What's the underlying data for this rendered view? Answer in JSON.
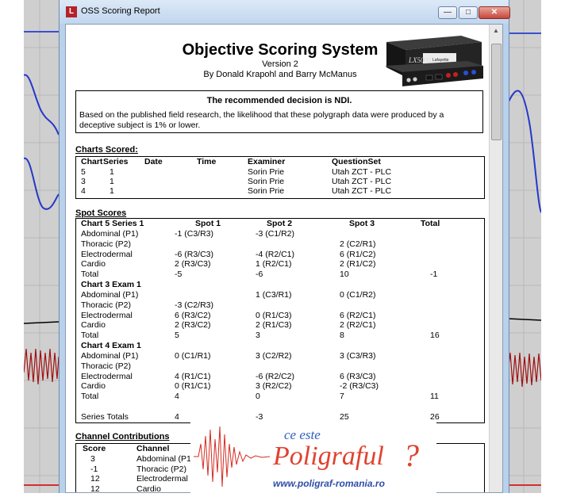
{
  "window": {
    "title": "OSS Scoring Report",
    "minimize_glyph": "—",
    "maximize_glyph": "□",
    "close_glyph": "✕",
    "app_icon_glyph": "L"
  },
  "report": {
    "title": "Objective Scoring System",
    "version": "Version 2",
    "authors": "By Donald Krapohl and Barry McManus",
    "device_label": "LX5000",
    "device_brand": "Lafayette"
  },
  "decision": {
    "title": "The recommended decision is NDI.",
    "text": "Based on the published field research, the likelihood that these polygraph data were produced by a deceptive subject is 1% or lower."
  },
  "charts_scored": {
    "label": "Charts Scored:",
    "headers": [
      "Chart",
      "Series",
      "Date",
      "Time",
      "Examiner",
      "QuestionSet"
    ],
    "rows": [
      [
        "5",
        "1",
        "",
        "",
        "Sorin Prie",
        "Utah ZCT - PLC"
      ],
      [
        "3",
        "1",
        "",
        "",
        "Sorin Prie",
        "Utah ZCT - PLC"
      ],
      [
        "4",
        "1",
        "",
        "",
        "Sorin Prie",
        "Utah ZCT - PLC"
      ]
    ]
  },
  "spot_scores": {
    "label": "Spot Scores",
    "headers": [
      "Spot 1",
      "Spot 2",
      "Spot 3",
      "Total"
    ],
    "groups": [
      {
        "title": "Chart 5 Series 1",
        "rows": [
          {
            "channel": "Abdominal (P1)",
            "s1": "-1 (C3/R3)",
            "s2": "-3 (C1/R2)",
            "s3": "",
            "total": ""
          },
          {
            "channel": "Thoracic (P2)",
            "s1": "",
            "s2": "",
            "s3": "2 (C2/R1)",
            "total": ""
          },
          {
            "channel": "Electrodermal",
            "s1": "-6 (R3/C3)",
            "s2": "-4 (R2/C1)",
            "s3": "6 (R1/C2)",
            "total": ""
          },
          {
            "channel": "Cardio",
            "s1": "2 (R3/C3)",
            "s2": "1 (R2/C1)",
            "s3": "2 (R1/C2)",
            "total": ""
          },
          {
            "channel": "Total",
            "s1": "-5",
            "s2": "-6",
            "s3": "10",
            "total": "-1"
          }
        ]
      },
      {
        "title": "Chart 3 Exam 1",
        "rows": [
          {
            "channel": "Abdominal (P1)",
            "s1": "",
            "s2": "1 (C3/R1)",
            "s3": "0 (C1/R2)",
            "total": ""
          },
          {
            "channel": "Thoracic (P2)",
            "s1": "-3 (C2/R3)",
            "s2": "",
            "s3": "",
            "total": ""
          },
          {
            "channel": "Electrodermal",
            "s1": "6 (R3/C2)",
            "s2": "0 (R1/C3)",
            "s3": "6 (R2/C1)",
            "total": ""
          },
          {
            "channel": "Cardio",
            "s1": "2 (R3/C2)",
            "s2": "2 (R1/C3)",
            "s3": "2 (R2/C1)",
            "total": ""
          },
          {
            "channel": "Total",
            "s1": "5",
            "s2": "3",
            "s3": "8",
            "total": "16"
          }
        ]
      },
      {
        "title": "Chart 4 Exam 1",
        "rows": [
          {
            "channel": "Abdominal (P1)",
            "s1": "0 (C1/R1)",
            "s2": "3 (C2/R2)",
            "s3": "3 (C3/R3)",
            "total": ""
          },
          {
            "channel": "Thoracic (P2)",
            "s1": "",
            "s2": "",
            "s3": "",
            "total": ""
          },
          {
            "channel": "Electrodermal",
            "s1": "4 (R1/C1)",
            "s2": "-6 (R2/C2)",
            "s3": "6 (R3/C3)",
            "total": ""
          },
          {
            "channel": "Cardio",
            "s1": "0 (R1/C1)",
            "s2": "3 (R2/C2)",
            "s3": "-2 (R3/C3)",
            "total": ""
          },
          {
            "channel": "Total",
            "s1": "4",
            "s2": "0",
            "s3": "7",
            "total": "11"
          }
        ]
      }
    ],
    "series_totals": {
      "label": "Series Totals",
      "s1": "4",
      "s2": "-3",
      "s3": "25",
      "total": "26"
    }
  },
  "channel_contributions": {
    "label": "Channel Contributions",
    "headers": [
      "Score",
      "Channel"
    ],
    "rows": [
      [
        "3",
        "Abdominal (P1)"
      ],
      [
        "-1",
        "Thoracic (P2)"
      ],
      [
        "12",
        "Electrodermal"
      ],
      [
        "12",
        "Cardio"
      ]
    ]
  },
  "watermark": {
    "line1": "ce este",
    "line2": "Poligraful",
    "question_mark": "?",
    "url": "www.poligraf-romania.ro"
  }
}
